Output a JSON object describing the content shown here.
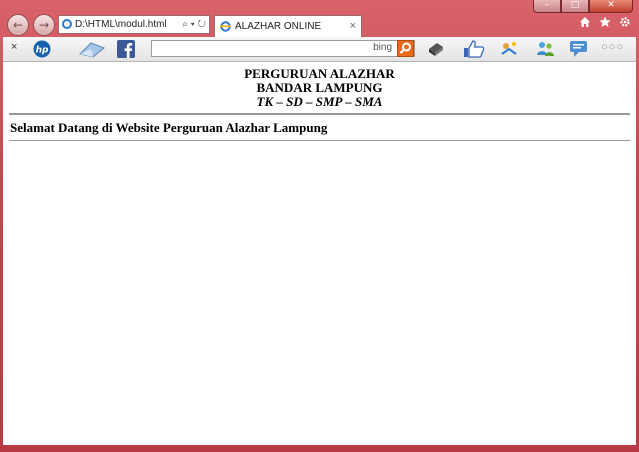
{
  "browser": {
    "address": "D:\\HTML\\modul.html",
    "address_tools": "⌕ ▾ ↻",
    "tab_title": "ALAZHAR ONLINE",
    "tab_close": "×",
    "caption_minimize": "–",
    "caption_maximize": "□",
    "caption_close": "✕",
    "nav_back": "←",
    "nav_forward": "→",
    "right_icons": [
      "home-icon",
      "favorites-star-icon",
      "tools-gear-icon"
    ]
  },
  "toolbar": {
    "close": "×",
    "search_placeholder": "",
    "search_engine": "bing",
    "more": "○○○",
    "icons": [
      "hp-icon",
      "mail-icon",
      "facebook-icon",
      "printer-icon",
      "like-thumb-icon",
      "sports-icon",
      "messenger-icon",
      "chat-icon"
    ]
  },
  "page": {
    "title_line1": "PERGURUAN ALAZHAR",
    "title_line2": "BANDAR LAMPUNG",
    "title_line3": "TK – SD – SMP – SMA",
    "welcome": "Selamat Datang di Website Perguruan Alazhar Lampung"
  },
  "colors": {
    "window_frame": "#c9454d",
    "facebook": "#3b5998",
    "bing_button": "#e86b1d"
  }
}
